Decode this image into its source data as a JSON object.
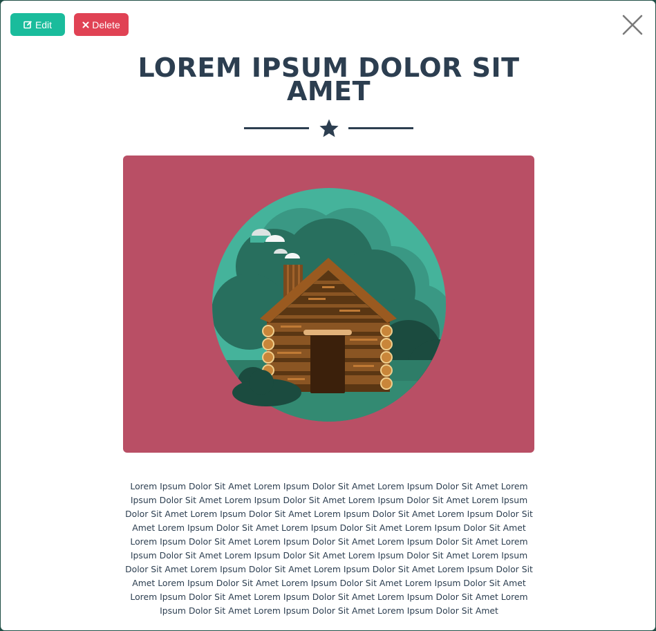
{
  "toolbar": {
    "edit_label": "Edit",
    "delete_label": "Delete",
    "edit_icon": "edit-icon",
    "delete_icon": "times-icon",
    "close_icon": "close-icon"
  },
  "modal": {
    "title": "LOREM IPSUM DOLOR SIT AMET",
    "divider_icon": "star-icon",
    "image_alt_icon": "log-cabin-illustration",
    "body": "Lorem Ipsum Dolor Sit Amet Lorem Ipsum Dolor Sit Amet Lorem Ipsum Dolor Sit Amet Lorem Ipsum Dolor Sit Amet Lorem Ipsum Dolor Sit Amet Lorem Ipsum Dolor Sit Amet Lorem Ipsum Dolor Sit Amet Lorem Ipsum Dolor Sit Amet Lorem Ipsum Dolor Sit Amet Lorem Ipsum Dolor Sit Amet Lorem Ipsum Dolor Sit Amet Lorem Ipsum Dolor Sit Amet Lorem Ipsum Dolor Sit Amet Lorem Ipsum Dolor Sit Amet Lorem Ipsum Dolor Sit Amet Lorem Ipsum Dolor Sit Amet Lorem Ipsum Dolor Sit Amet Lorem Ipsum Dolor Sit Amet Lorem Ipsum Dolor Sit Amet Lorem Ipsum Dolor Sit Amet Lorem Ipsum Dolor Sit Amet Lorem Ipsum Dolor Sit Amet Lorem Ipsum Dolor Sit Amet Lorem Ipsum Dolor Sit Amet Lorem Ipsum Dolor Sit Amet Lorem Ipsum Dolor Sit Amet Lorem Ipsum Dolor Sit Amet Lorem Ipsum Dolor Sit Amet Lorem Ipsum Dolor Sit Amet Lorem Ipsum Dolor Sit Amet Lorem Ipsum Dolor Sit Amet Lorem Ipsum Dolor Sit Amet"
  },
  "colors": {
    "edit_button": "#1abc9c",
    "delete_button": "#e04254",
    "heading": "#2c3e50",
    "image_background": "#b94f65"
  }
}
